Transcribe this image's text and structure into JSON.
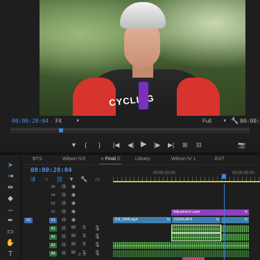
{
  "program_monitor": {
    "timecode": "00:00:28:04",
    "zoom": "Fit",
    "resolution": "Full",
    "end_timecode": "00:00:3",
    "video_jersey_text": "CYCLING",
    "transport_icons": [
      "marker-icon",
      "in-point-icon",
      "out-point-icon",
      "go-to-in-icon",
      "step-back-icon",
      "play-icon",
      "step-forward-icon",
      "go-to-out-icon",
      "insert-icon",
      "overwrite-icon",
      "export-frame-icon"
    ]
  },
  "tools": [
    "selection-tool",
    "track-select-tool",
    "ripple-edit-tool",
    "razor-tool",
    "slip-tool",
    "pen-tool",
    "rectangle-tool",
    "hand-tool",
    "type-tool"
  ],
  "timeline": {
    "tabs": [
      "BTS",
      "Wilson IV2",
      "Final",
      "Library",
      "Wilson IV 1",
      "EXT"
    ],
    "active_tab": "Final",
    "timecode": "00:00:28:04",
    "ruler_labels": [
      "00:00:15:00",
      "00:00:30:00"
    ],
    "tracks": [
      {
        "name": "V5",
        "target": ""
      },
      {
        "name": "V4",
        "target": ""
      },
      {
        "name": "V3",
        "target": ""
      },
      {
        "name": "V2",
        "target": ""
      },
      {
        "name": "V1",
        "target": "V1"
      },
      {
        "name": "A1",
        "target": "A1"
      },
      {
        "name": "A2",
        "target": "A2"
      },
      {
        "name": "A3",
        "target": "A3"
      },
      {
        "name": "A4",
        "target": "A4"
      },
      {
        "name": "A5",
        "target": "A5"
      }
    ],
    "audio_controls": {
      "mute": "M",
      "solo": "S"
    },
    "clips": {
      "adjustment_layer": "Adjustment Layer",
      "v1_clip_1": "DJI_0096.mp4",
      "v1_clip_2": "C0206.MP4",
      "fx": "fx"
    },
    "bottom_value": "0.0",
    "colors": {
      "playhead": "#3b84e0",
      "video_clip": "#3f7fb0",
      "adjustment_layer": "#8f3fbf",
      "audio_clip": "#2b6b2a",
      "audio_clip_alt": "#b2326b",
      "work_area": "#d6c33a"
    }
  }
}
